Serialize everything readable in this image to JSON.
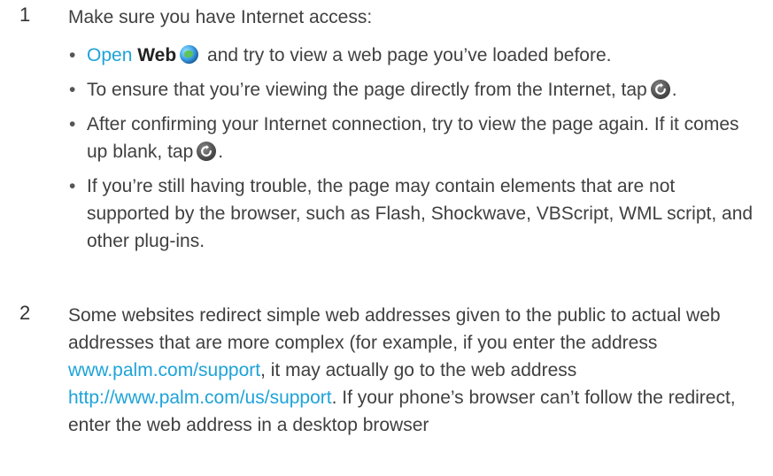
{
  "step1": {
    "number": "1",
    "intro": "Make sure you have Internet access:",
    "bullets": {
      "b1": {
        "link": "Open",
        "bold": "Web",
        "text": "and try to view a web page you’ve loaded before."
      },
      "b2": {
        "text": "To ensure that you’re viewing the page directly from the Internet, tap",
        "end": "."
      },
      "b3": {
        "text": "After confirming your Internet connection, try to view the page again. If it comes up blank, tap",
        "end": "."
      },
      "b4": {
        "text": "If you’re still having trouble, the page may contain elements that are not supported by the browser, such as Flash, Shockwave, VBScript, WML script, and other plug-ins."
      }
    }
  },
  "step2": {
    "number": "2",
    "text_a": "Some websites redirect simple web addresses given to the public to actual web addresses that are more complex (for example, if you enter the address",
    "link_a": "www.palm.com/support",
    "text_b": ", it may actually go to the web address",
    "link_b": "http://www.palm.com/us/support",
    "text_c": ". If your phone’s browser can’t follow the redirect, enter the web address in a desktop browser"
  },
  "icons": {
    "web_app": "globe-icon",
    "reload": "reload-icon"
  },
  "colors": {
    "link": "#1ea3d9",
    "text": "#404040"
  }
}
